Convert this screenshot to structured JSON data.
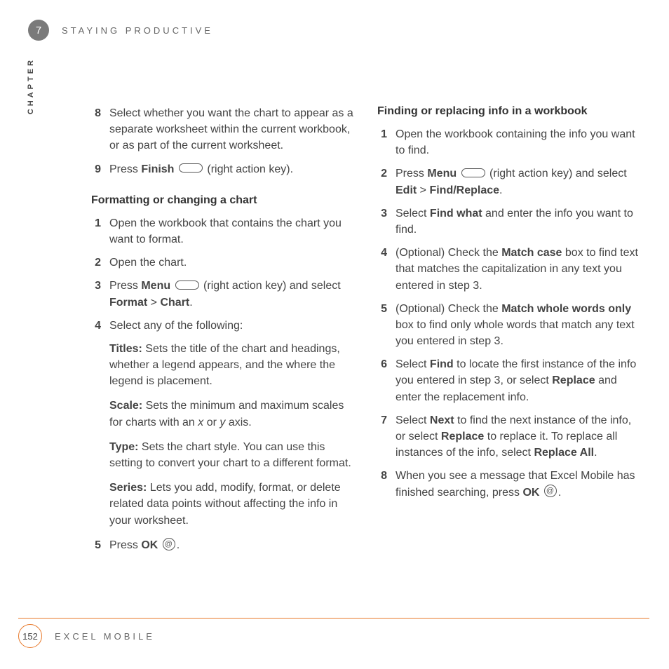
{
  "header": {
    "chapter_number": "7",
    "chapter_title": "STAYING PRODUCTIVE",
    "sidebar_label": "CHAPTER"
  },
  "left": {
    "step8_num": "8",
    "step8_text": "Select whether you want the chart to appear as a separate worksheet within the current workbook, or as part of the current worksheet.",
    "step9_num": "9",
    "step9_pre": "Press ",
    "step9_b": "Finish",
    "step9_post": " (right action key).",
    "sectionA": "Formatting or changing a chart",
    "a1_num": "1",
    "a1_text": "Open the workbook that contains the chart you want to format.",
    "a2_num": "2",
    "a2_text": "Open the chart.",
    "a3_num": "3",
    "a3_pre": "Press ",
    "a3_b1": "Menu",
    "a3_mid": " (right action key) and select ",
    "a3_b2": "Format",
    "a3_gt": " > ",
    "a3_b3": "Chart",
    "a3_end": ".",
    "a4_num": "4",
    "a4_text": "Select any of the following:",
    "titles_b": "Titles:",
    "titles_txt": " Sets the title of the chart and headings, whether a legend appears, and the where the legend is placement.",
    "scale_b": "Scale:",
    "scale_txt_pre": " Sets the minimum and maximum scales for charts with an ",
    "scale_x": "x",
    "scale_or": " or ",
    "scale_y": "y",
    "scale_txt_post": " axis.",
    "type_b": "Type:",
    "type_txt": " Sets the chart style. You can use this setting to convert your chart to a different format.",
    "series_b": "Series:",
    "series_txt": " Lets you add, modify, format, or delete related data points without affecting the info in your worksheet.",
    "a5_num": "5",
    "a5_pre": "Press ",
    "a5_b": "OK",
    "a5_post": "."
  },
  "right": {
    "sectionB": "Finding or replacing info in a workbook",
    "b1_num": "1",
    "b1_text": "Open the workbook containing the info you want to find.",
    "b2_num": "2",
    "b2_pre": "Press ",
    "b2_b1": "Menu",
    "b2_mid": " (right action key) and select ",
    "b2_b2": "Edit",
    "b2_gt": " > ",
    "b2_b3": "Find/Replace",
    "b2_end": ".",
    "b3_num": "3",
    "b3_pre": "Select ",
    "b3_b": "Find what",
    "b3_post": " and enter the info you want to find.",
    "b4_num": "4",
    "b4_pre": "(Optional) Check the ",
    "b4_b": "Match case",
    "b4_post": " box to find text that matches the capitalization in any text you entered in step 3.",
    "b5_num": "5",
    "b5_pre": "(Optional) Check the ",
    "b5_b": "Match whole words only",
    "b5_post": " box to find only whole words that match any text you entered in step 3.",
    "b6_num": "6",
    "b6_pre": "Select ",
    "b6_b1": "Find",
    "b6_mid": " to locate the first instance of the info you entered in step 3, or select ",
    "b6_b2": "Replace",
    "b6_post": " and enter the replacement info.",
    "b7_num": "7",
    "b7_pre": "Select ",
    "b7_b1": "Next",
    "b7_mid": " to find the next instance of the info, or select ",
    "b7_b2": "Replace",
    "b7_mid2": " to replace it. To replace all instances of the info, select ",
    "b7_b3": "Replace All",
    "b7_end": ".",
    "b8_num": "8",
    "b8_pre": "When you see a message that Excel Mobile has finished searching, press ",
    "b8_b": "OK",
    "b8_end": "."
  },
  "footer": {
    "page_number": "152",
    "footer_title": "EXCEL MOBILE"
  }
}
